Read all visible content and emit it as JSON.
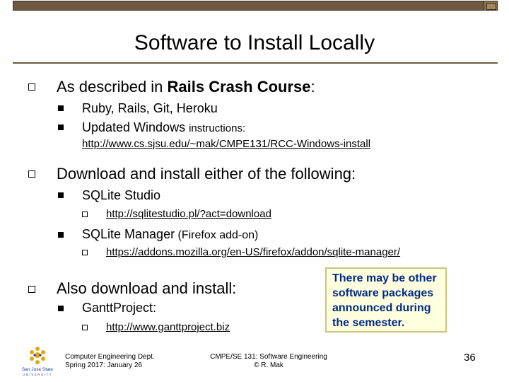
{
  "slide": {
    "title": "Software to Install Locally",
    "bullets": [
      {
        "text_prefix": "As described in ",
        "text_bold": "Rails Crash Course",
        "text_suffix": ":",
        "children": [
          {
            "text": "Ruby, Rails, Git, Heroku"
          },
          {
            "text_main": "Updated Windows ",
            "text_small": "instructions:"
          }
        ],
        "link": "http://www.cs.sjsu.edu/~mak/CMPE131/RCC-Windows-install"
      },
      {
        "text": "Download and install either of the following:",
        "children": [
          {
            "text": "SQLite Studio",
            "link": "http://sqlitestudio.pl/?act=download"
          },
          {
            "text_main": "SQLite Manager",
            "text_small": " (Firefox add-on)",
            "link": "https://addons.mozilla.org/en-US/firefox/addon/sqlite-manager/"
          }
        ]
      },
      {
        "text": "Also download and install:",
        "children": [
          {
            "text": "GanttProject:",
            "link": "http://www.ganttproject.biz"
          }
        ]
      }
    ],
    "callout": [
      "There may be other",
      "software packages",
      "announced during",
      "the semester."
    ]
  },
  "footer": {
    "left_line1": "Computer Engineering Dept.",
    "left_line2": "Spring 2017: January 26",
    "center_line1": "CMPE/SE 131: Software Engineering",
    "center_line2": "© R. Mak",
    "page_number": "36",
    "logo_text": "San José State",
    "logo_subtext": "UNIVERSITY"
  }
}
